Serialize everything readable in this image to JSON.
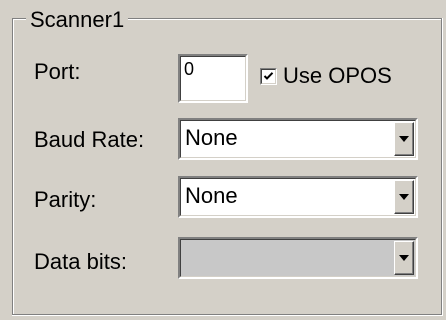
{
  "groupbox": {
    "title": "Scanner1"
  },
  "port": {
    "label": "Port:",
    "value": "0"
  },
  "use_opos": {
    "label": "Use OPOS",
    "checked": true
  },
  "baud_rate": {
    "label": "Baud Rate:",
    "selected": "None",
    "enabled": true
  },
  "parity": {
    "label": "Parity:",
    "selected": "None",
    "enabled": true
  },
  "data_bits": {
    "label": "Data bits:",
    "selected": "",
    "enabled": false
  },
  "icons": {
    "dropdown": "chevron-down-icon",
    "check": "check-icon"
  },
  "colors": {
    "face": "#d4d0c8",
    "disabled_field": "#c8c8c8",
    "field": "#ffffff"
  }
}
